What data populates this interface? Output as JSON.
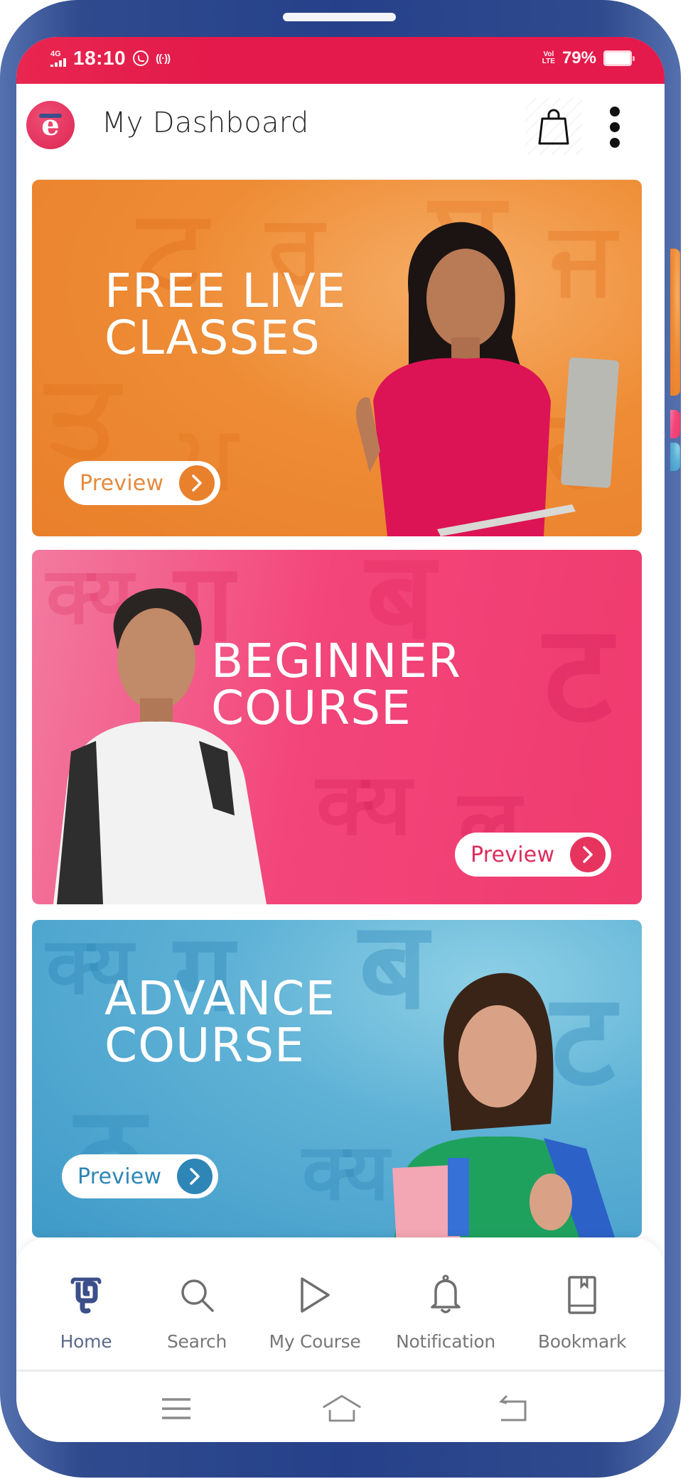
{
  "status_bar": {
    "network": "4G",
    "time": "18:10",
    "notification_icons": [
      "whatsapp-icon",
      "hotspot-icon"
    ],
    "volte": "Vol LTE",
    "battery_percent": "79%",
    "battery_level": 0.79
  },
  "header": {
    "logo_glyph": "e",
    "title": "My Dashboard",
    "cart_icon": "shopping-bag-icon",
    "menu_icon": "more-vertical-icon"
  },
  "banners": [
    {
      "headline": "FREE LIVE\nCLASSES",
      "cta_label": "Preview",
      "accent": "#e9802c",
      "theme": "orange"
    },
    {
      "headline": "BEGINNER\nCOURSE",
      "cta_label": "Preview",
      "accent": "#e6345f",
      "theme": "pink"
    },
    {
      "headline": "ADVANCE\nCOURSE",
      "cta_label": "Preview",
      "accent": "#2e86b6",
      "theme": "blue"
    }
  ],
  "bottom_nav": {
    "active": "Home",
    "items": [
      {
        "label": "Home",
        "icon": "home-logo-icon"
      },
      {
        "label": "Search",
        "icon": "search-icon"
      },
      {
        "label": "My Course",
        "icon": "play-icon"
      },
      {
        "label": "Notification",
        "icon": "bell-icon"
      },
      {
        "label": "Bookmark",
        "icon": "bookmark-book-icon"
      }
    ]
  },
  "system_nav": {
    "buttons": [
      "recents-menu-icon",
      "home-icon",
      "back-icon"
    ]
  },
  "colors": {
    "status_bar": "#e31a4b",
    "frame": "#26418a",
    "active_nav_icon": "#3b4f8a",
    "nav_text": "#777777"
  }
}
